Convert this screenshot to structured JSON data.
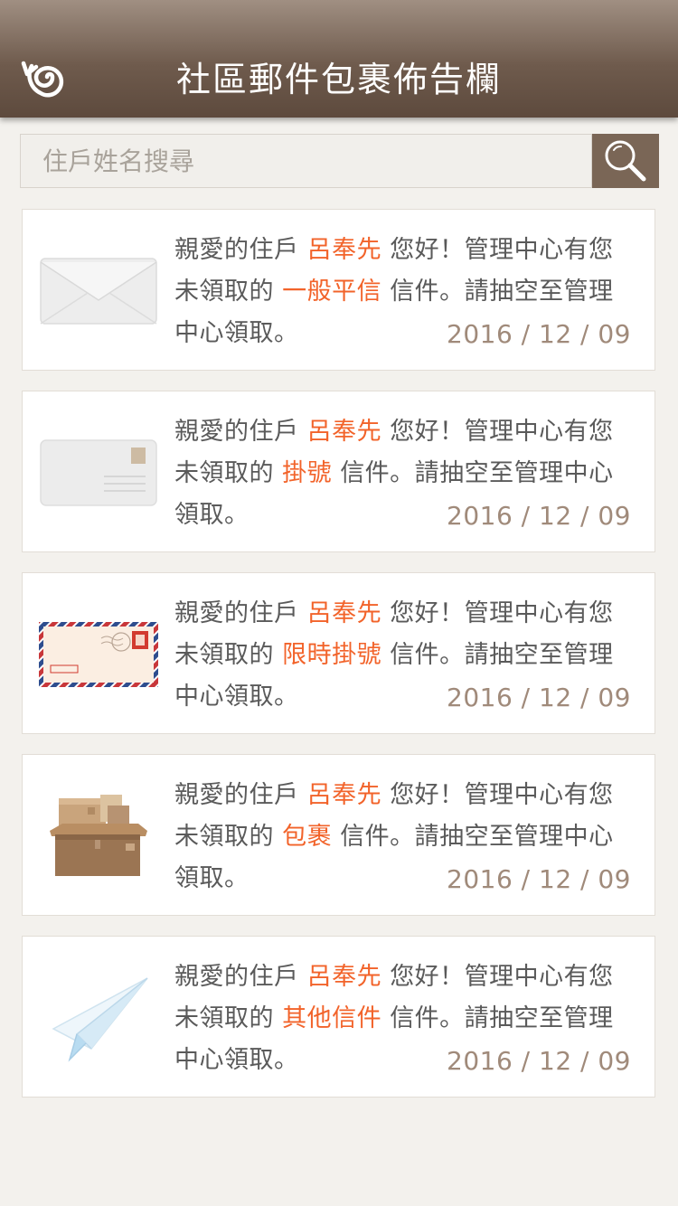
{
  "header": {
    "title": "社區郵件包裹佈告欄"
  },
  "search": {
    "placeholder": "住戶姓名搜尋"
  },
  "notices": [
    {
      "greeting": "親愛的住戶",
      "name": "呂奉先",
      "mid": "您好！管理中心有您未領取的",
      "mail_type": "一般平信",
      "tail": "信件。請抽空至管理中心領取。",
      "date": "2016 / 12 / 09",
      "icon": "envelope-icon"
    },
    {
      "greeting": "親愛的住戶",
      "name": "呂奉先",
      "mid": "您好！管理中心有您未領取的",
      "mail_type": "掛號",
      "tail": "信件。請抽空至管理中心領取。",
      "date": "2016 / 12 / 09",
      "icon": "postcard-icon"
    },
    {
      "greeting": "親愛的住戶",
      "name": "呂奉先",
      "mid": "您好！管理中心有您未領取的",
      "mail_type": "限時掛號",
      "tail": "信件。請抽空至管理中心領取。",
      "date": "2016 / 12 / 09",
      "icon": "airmail-envelope-icon"
    },
    {
      "greeting": "親愛的住戶",
      "name": "呂奉先",
      "mid": "您好！管理中心有您未領取的",
      "mail_type": "包裹",
      "tail": "信件。請抽空至管理中心領取。",
      "date": "2016 / 12 / 09",
      "icon": "package-boxes-icon"
    },
    {
      "greeting": "親愛的住戶",
      "name": "呂奉先",
      "mid": "您好！管理中心有您未領取的",
      "mail_type": "其他信件",
      "tail": "信件。請抽空至管理中心領取。",
      "date": "2016 / 12 / 09",
      "icon": "paper-plane-icon"
    }
  ],
  "colors": {
    "header_top": "#a08f82",
    "header_bottom": "#5d4a3d",
    "highlight": "#f2632a",
    "date": "#a08a7a",
    "search_button": "#7a6656"
  }
}
